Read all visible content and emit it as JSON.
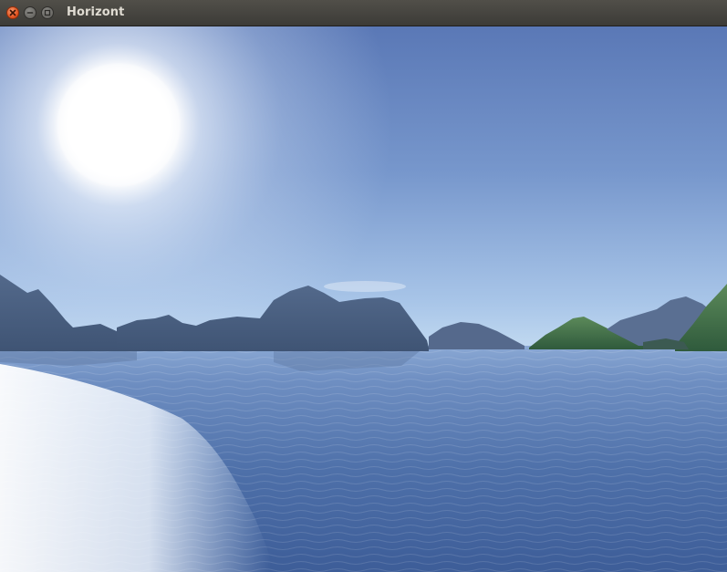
{
  "window": {
    "title": "Horizont",
    "controls": {
      "close_icon": "close-icon",
      "minimize_icon": "minimize-icon",
      "maximize_icon": "maximize-icon"
    }
  },
  "scene": {
    "colors": {
      "sky_top": "#5b7ab8",
      "sky_horizon": "#b4d0ee",
      "sun": "#ffffff",
      "water_near": "#3e5f99",
      "water_far": "#8ba9d6",
      "mountains": "#4b5f7e",
      "island_green": "#3f6f45"
    }
  }
}
